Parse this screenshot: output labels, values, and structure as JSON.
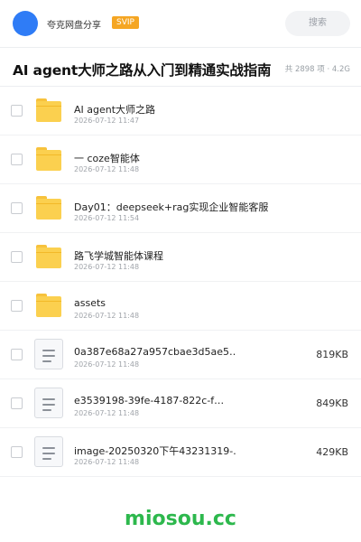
{
  "header": {
    "share_name": "夸克网盘分享",
    "badge": "SVIP",
    "search_label": "搜索"
  },
  "title_bar": {
    "title": "AI agent大师之路从入门到精通实战指南",
    "meta": "共 2898 项 · 4.2G"
  },
  "files": [
    {
      "type": "folder",
      "name": "AI agent大师之路",
      "date": "2026-07-12 11:47",
      "size": ""
    },
    {
      "type": "folder",
      "name": "一 coze智能体",
      "date": "2026-07-12 11:48",
      "size": ""
    },
    {
      "type": "folder",
      "name": "Day01：deepseek+rag实现企业智能客服",
      "date": "2026-07-12 11:54",
      "size": ""
    },
    {
      "type": "folder",
      "name": "路飞学城智能体课程",
      "date": "2026-07-12 11:48",
      "size": ""
    },
    {
      "type": "folder",
      "name": "assets",
      "date": "2026-07-12 11:48",
      "size": ""
    },
    {
      "type": "file",
      "name": "0a387e68a27a957cbae3d5ae5…",
      "date": "2026-07-12 11:48",
      "size": "819KB"
    },
    {
      "type": "file",
      "name": "e3539198-39fe-4187-822c-f…",
      "date": "2026-07-12 11:48",
      "size": "849KB"
    },
    {
      "type": "file",
      "name": "image-20250320下午43231319-…",
      "date": "2026-07-12 11:48",
      "size": "429KB"
    }
  ],
  "watermark": "miosou.cc",
  "colors": {
    "accent": "#2f7cf6",
    "svip": "#f5a623",
    "folder": "#fbd04f",
    "watermark": "#2db84d"
  }
}
